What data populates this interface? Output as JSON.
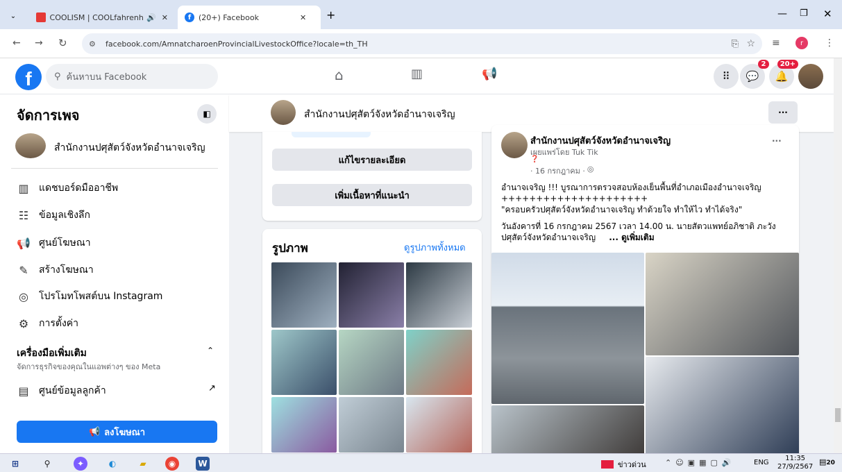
{
  "browser": {
    "tabs": [
      {
        "label": "COOLISM | COOLfahrenheit",
        "active": false
      },
      {
        "label": "(20+) Facebook",
        "active": true
      }
    ],
    "url": "facebook.com/AmnatcharoenProvincialLivestockOffice?locale=th_TH"
  },
  "header": {
    "search_placeholder": "ค้นหาบน Facebook",
    "messenger_badge": "2",
    "notif_badge": "20+"
  },
  "sidebar": {
    "title": "จัดการเพจ",
    "page_name": "สำนักงานปศุสัตว์จังหวัดอำนาจเจริญ",
    "items": [
      {
        "label": "แดชบอร์ดมืออาชีพ",
        "icon": "dashboard-icon",
        "glyph": "▥"
      },
      {
        "label": "ข้อมูลเชิงลึก",
        "icon": "insights-icon",
        "glyph": "☷"
      },
      {
        "label": "ศูนย์โฆษณา",
        "icon": "megaphone-icon",
        "glyph": "📢"
      },
      {
        "label": "สร้างโฆษณา",
        "icon": "pencil-icon",
        "glyph": "✎"
      },
      {
        "label": "โปรโมทโพสต์บน Instagram",
        "icon": "instagram-icon",
        "glyph": "◎"
      },
      {
        "label": "การตั้งค่า",
        "icon": "gear-icon",
        "glyph": "⚙"
      }
    ],
    "tools_title": "เครื่องมือเพิ่มเติม",
    "tools_subtitle": "จัดการธุรกิจของคุณในแอพต่างๆ ของ Meta",
    "customer_center": "ศูนย์ข้อมูลลูกค้า",
    "promote_button": "ลงโฆษณา"
  },
  "pagebar": {
    "name": "สำนักงานปศุสัตว์จังหวัดอำนาจเจริญ",
    "more": "···"
  },
  "left_col": {
    "edit_details": "แก้ไขรายละเอียด",
    "add_featured": "เพิ่มเนื้อหาที่แนะนำ",
    "photos_title": "รูปภาพ",
    "see_all_photos": "ดูรูปภาพทั้งหมด"
  },
  "post": {
    "author": "สำนักงานปศุสัตว์จังหวัดอำนาจเจริญ",
    "published_by": "เผยแพร่โดย Tuk Tik",
    "date": "· 16 กรกฎาคม ·",
    "line1": "อำนาจเจริญ !!! บูรณาการตรวจสอบห้องเย็นพื้นที่อำเภอเมืองอำนาจเจริญ",
    "line2": "+++++++++++++++++++++",
    "line3": "\"ครอบครัวปศุสัตว์จังหวัดอำนาจเจริญ ทำด้วยใจ ทำให้ไว ทำได้จริง\"",
    "line4": "วันอังคารที่ 16 กรกฎาคม 2567 เวลา 14.00 น. นายสัตวแพทย์อภิชาติ ภะวัง",
    "line5": "ปศุสัตว์จังหวัดอำนาจเจริญ",
    "see_more": "... ดูเพิ่มเติม",
    "more": "···"
  },
  "taskbar": {
    "news": "ข่าวด่วน",
    "lang": "ENG",
    "time": "11:35",
    "date": "27/9/2567",
    "notif": "20"
  }
}
